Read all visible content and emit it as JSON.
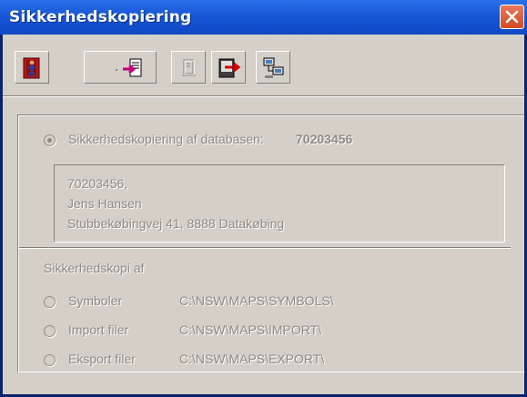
{
  "window": {
    "title": "Sikkerhedskopiering"
  },
  "toolbar": {
    "buttons": [
      {
        "name": "exit",
        "icon": "exit-door-icon",
        "enabled": true
      },
      {
        "name": "backup-to",
        "icon": "backup-arrow-icon",
        "enabled": true
      },
      {
        "name": "device",
        "icon": "device-icon",
        "enabled": false
      },
      {
        "name": "restore",
        "icon": "restore-arrow-icon",
        "enabled": true
      },
      {
        "name": "network",
        "icon": "network-computers-icon",
        "enabled": true
      }
    ]
  },
  "database": {
    "radio_label": "Sikkerhedskopiering af databasen:",
    "number": "70203456",
    "selected": true,
    "info_lines": [
      "70203456,",
      "Jens Hansen",
      "Stubbekøbingvej 41, 8888 Datakøbing"
    ]
  },
  "copy": {
    "heading": "Sikkerhedskopi af",
    "options": [
      {
        "label": "Symboler",
        "path": "C:\\NSW\\MAPS\\SYMBOLS\\"
      },
      {
        "label": "Import filer",
        "path": "C:\\NSW\\MAPS\\IMPORT\\"
      },
      {
        "label": "Eksport filer",
        "path": "C:\\NSW\\MAPS\\EXPORT\\"
      }
    ]
  },
  "colors": {
    "titlebar": "#1656d6",
    "frame": "#0a246a",
    "face": "#d4d0c8",
    "disabled_text": "#8e8a84",
    "close": "#d44a22"
  }
}
